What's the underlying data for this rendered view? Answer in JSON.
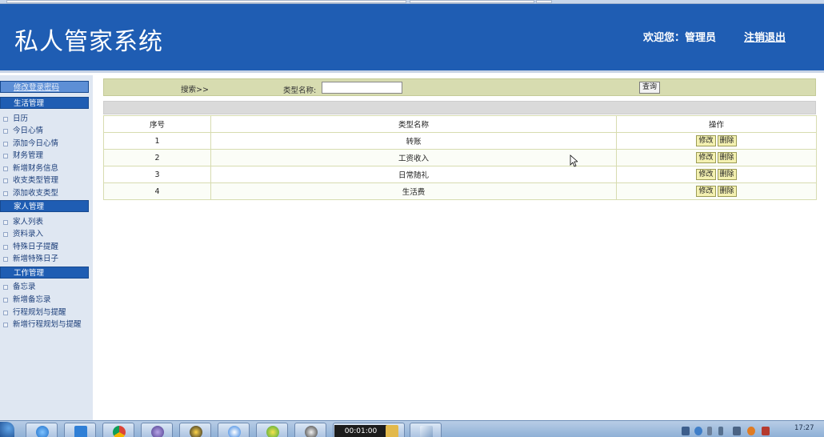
{
  "header": {
    "title": "私人管家系统",
    "welcome": "欢迎您：管理员",
    "logout": "注销退出"
  },
  "sidebar": {
    "change_password": "修改登录密码",
    "sections": [
      {
        "title": "生活管理",
        "items": [
          "日历",
          "今日心情",
          "添加今日心情",
          "财务管理",
          "新增财务信息",
          "收支类型管理",
          "添加收支类型"
        ]
      },
      {
        "title": "家人管理",
        "items": [
          "家人列表",
          "资料录入",
          "特殊日子提醒",
          "新增特殊日子"
        ]
      },
      {
        "title": "工作管理",
        "items": [
          "备忘录",
          "新增备忘录",
          "行程规划与提醒",
          "新增行程规划与提醒"
        ]
      }
    ]
  },
  "search": {
    "label": "搜索>>",
    "type_label": "类型名称:",
    "type_value": "",
    "button": "查询"
  },
  "table": {
    "headers": [
      "序号",
      "类型名称",
      "操作"
    ],
    "rows": [
      {
        "id": "1",
        "name": "转账"
      },
      {
        "id": "2",
        "name": "工资收入"
      },
      {
        "id": "3",
        "name": "日常随礼"
      },
      {
        "id": "4",
        "name": "生活费"
      }
    ],
    "edit_label": "修改",
    "delete_label": "删除"
  },
  "taskbar": {
    "clock": "17:27",
    "active_window_time": "00:01:00"
  },
  "colors": {
    "header_bg": "#1f5db3",
    "searchbar_bg": "#d7dcb0",
    "action_button_bg": "#f4f1b1"
  },
  "icons": {
    "start": "windows-start-orb-icon",
    "taskbar": [
      "ie-browser-icon",
      "windows-explorer-icon",
      "chrome-icon",
      "eclipse-icon",
      "qq-icon",
      "baidu-icon",
      "360-browser-icon",
      "user-avatar-icon",
      "sticky-notes-icon",
      "folder-icon",
      "screenshot-tool-icon"
    ],
    "tray": [
      "network-icon",
      "help-icon",
      "input-method-icon",
      "expand-tray-icon",
      "volume-icon",
      "qq-tray-icon",
      "flash-icon"
    ]
  }
}
